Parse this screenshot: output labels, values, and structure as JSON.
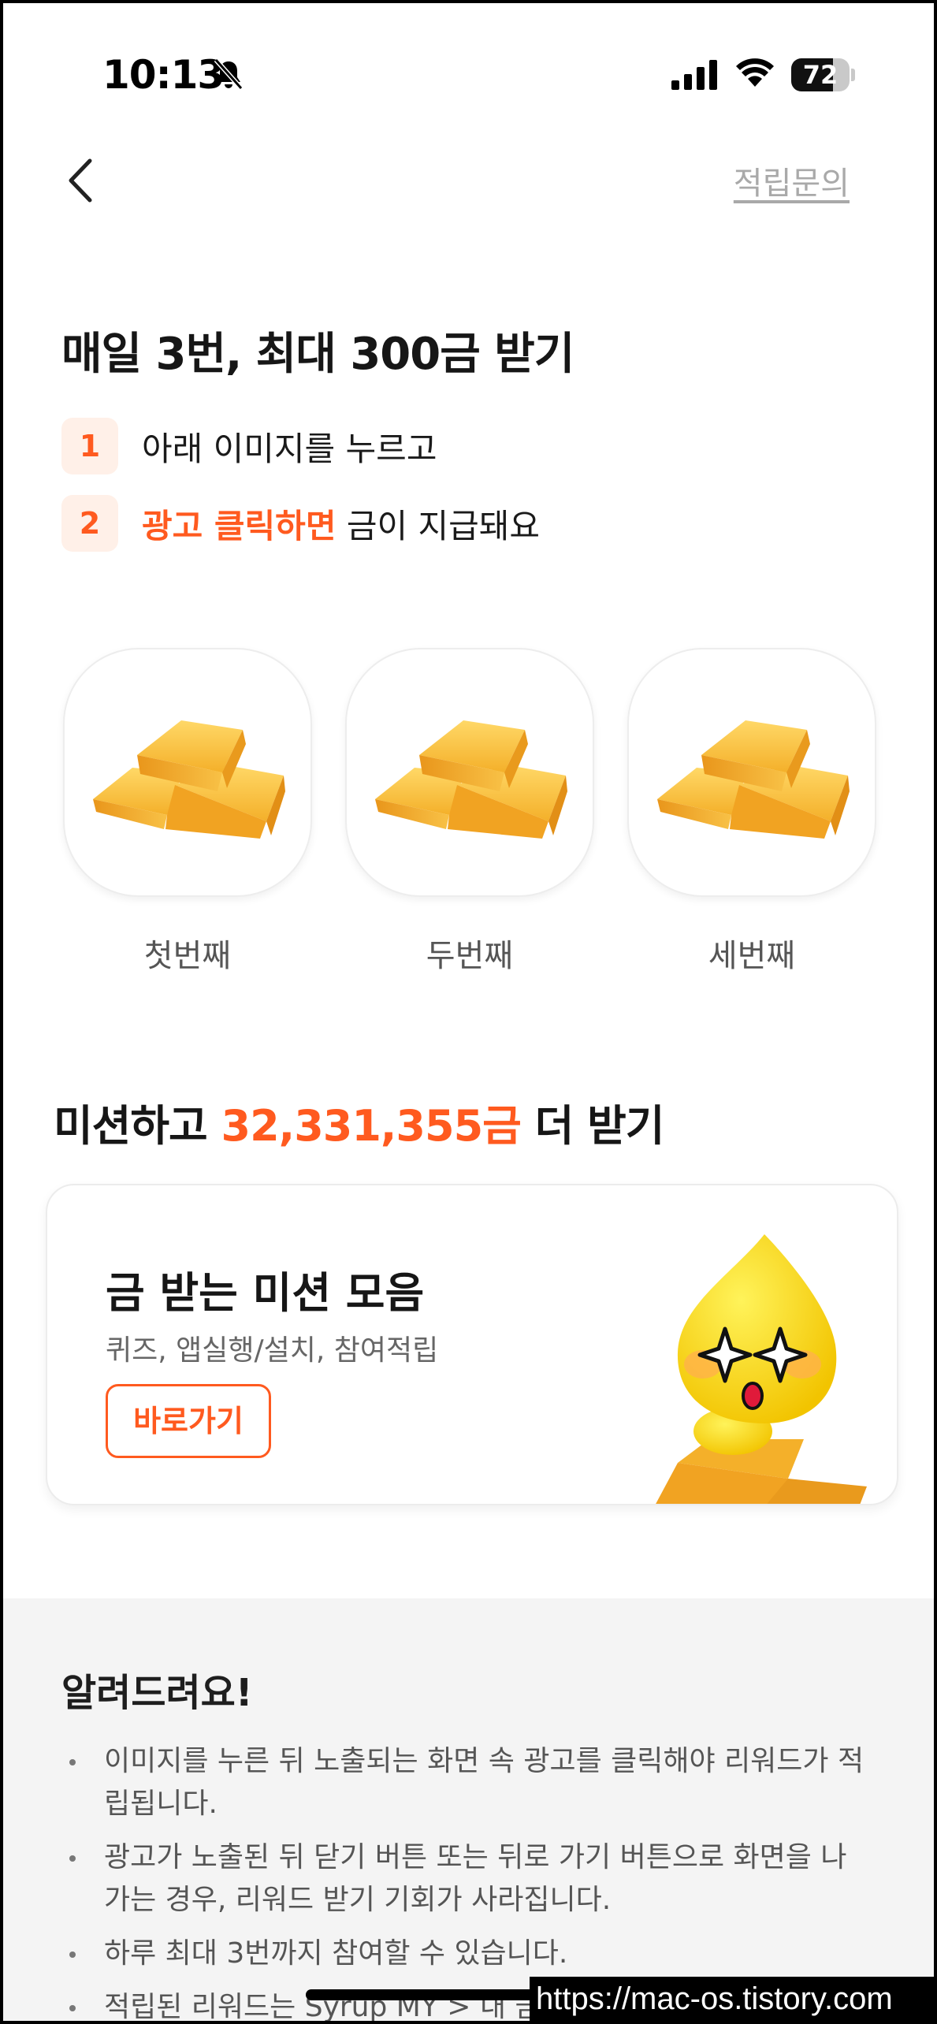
{
  "status_bar": {
    "time": "10:13",
    "battery": "72",
    "battery_level": 0.72
  },
  "nav": {
    "back_icon": "chevron-left-icon",
    "inquiry_label": "적립문의"
  },
  "header": {
    "title": "매일 3번, 최대 300금 받기",
    "steps": [
      {
        "number": "1",
        "highlight": "",
        "text": "아래 이미지를 누르고"
      },
      {
        "number": "2",
        "highlight": "광고 클릭하면",
        "text": " 금이 지급돼요"
      }
    ]
  },
  "gold_items": [
    {
      "label": "첫번째",
      "icon": "gold-bars-icon"
    },
    {
      "label": "두번째",
      "icon": "gold-bars-icon"
    },
    {
      "label": "세번째",
      "icon": "gold-bars-icon"
    }
  ],
  "mission": {
    "title_prefix": "미션하고 ",
    "amount": "32,331,355금",
    "title_suffix": " 더 받기",
    "card": {
      "title": "금 받는 미션 모음",
      "subtitle": "퀴즈, 앱실행/설치, 참여적립",
      "button": "바로가기",
      "mascot_icon": "mascot-icon"
    }
  },
  "notice": {
    "title": "알려드려요!",
    "items": [
      "이미지를 누른 뒤 노출되는 화면 속 광고를 클릭해야 리워드가 적립됩니다.",
      "광고가 노출된 뒤 닫기 버튼 또는 뒤로 가기 버튼으로 화면을 나가는 경우, 리워드 받기 기회가 사라집니다.",
      "하루 최대 3번까지 참여할 수 있습니다.",
      "적립된 리워드는 Syrup MY > 내 금"
    ]
  },
  "watermark": "https://mac-os.tistory.com",
  "colors": {
    "accent": "#ff5a1f",
    "gold": "#f5b52a",
    "background": "#ffffff",
    "notice_bg": "#f4f4f4"
  }
}
